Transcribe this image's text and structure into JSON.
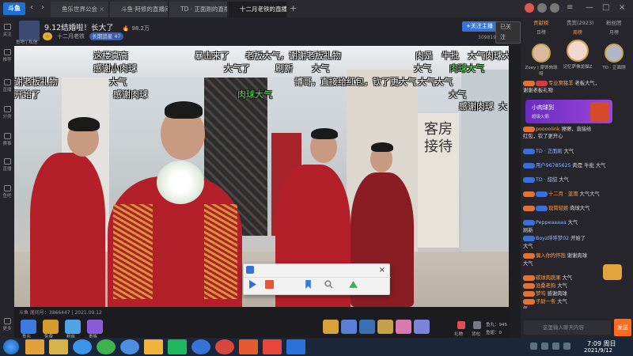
{
  "app": {
    "logo": "斗鱼",
    "nav_back": "‹",
    "nav_fwd": "›"
  },
  "tabs": [
    {
      "label": "鱼乐世界公会",
      "active": false
    },
    {
      "label": "斗鱼·阿修的直播间",
      "active": false
    },
    {
      "label": "TD · 正面刚的直播间",
      "active": false
    },
    {
      "label": "十二月老铁的直播间",
      "active": true
    }
  ],
  "tab_close": "×",
  "tab_new": "+",
  "window_controls": {
    "menu": "≡",
    "minimize": "—",
    "maximize": "□",
    "close": "×"
  },
  "sidebar": [
    {
      "label": "关注",
      "icon": "heart-icon"
    },
    {
      "label": "推荐",
      "icon": "home-icon"
    },
    {
      "label": "直播",
      "icon": "tv-icon"
    },
    {
      "label": "分类",
      "icon": "grid-icon"
    },
    {
      "label": "赛事",
      "icon": "trophy-icon"
    },
    {
      "label": "直播",
      "icon": "camera-icon"
    },
    {
      "label": "鱼吧",
      "icon": "fish-icon"
    },
    {
      "label": "更多",
      "icon": "more-icon"
    }
  ],
  "room": {
    "title": "9.12结婚啦！长大了",
    "heat": "98.2万",
    "sub_label": "十二月老铁",
    "level_badge": "长期追星 47",
    "follow_btn": "+关注主播",
    "share_btn": "已关注",
    "followers": "309819",
    "anchor_name": "鱼吧 | 私信"
  },
  "danmaku": [
    {
      "text": "这楼真高",
      "green": false
    },
    {
      "text": "暴击来了",
      "green": false
    },
    {
      "text": "老板大气，谢谢老板礼物",
      "green": false
    },
    {
      "text": "肉是",
      "green": false
    },
    {
      "text": "牛批",
      "green": false
    },
    {
      "text": "大气",
      "green": false
    },
    {
      "text": "肉球大气",
      "green": false
    },
    {
      "text": "感谢小肉球",
      "green": false
    },
    {
      "text": "大气了",
      "green": false
    },
    {
      "text": "大气",
      "green": false
    },
    {
      "text": "大气",
      "green": false
    },
    {
      "text": "肉球大气",
      "green": true
    },
    {
      "text": "谢老板礼物",
      "green": false
    },
    {
      "text": "大气",
      "green": false
    },
    {
      "text": "刷新",
      "green": false
    },
    {
      "text": "博哥，直接给红包，钦了更大气",
      "green": false
    },
    {
      "text": "大气大气",
      "green": false
    },
    {
      "text": "开始了",
      "green": false
    },
    {
      "text": "感谢肉球",
      "green": false
    },
    {
      "text": "肉球大气",
      "green": true
    },
    {
      "text": "大气",
      "green": false
    },
    {
      "text": "感谢肉球",
      "green": false
    },
    {
      "text": "大",
      "green": false
    }
  ],
  "sign_text": "客房接待",
  "video_footer": {
    "room_id": "斗鱼 房间号：3866447 | 2021.09.12"
  },
  "gifts_left": [
    {
      "label": "鱼丸",
      "color": "#3e7be0"
    },
    {
      "label": "免费",
      "color": "#d79b2c"
    },
    {
      "label": "粉丝",
      "color": "#4fa3e6"
    },
    {
      "label": "贵族",
      "color": "#8b5bd8"
    }
  ],
  "gifts_right": [
    {
      "label": "",
      "color": "#d8a13a"
    },
    {
      "label": "",
      "color": "#5a7fd6"
    },
    {
      "label": "",
      "color": "#3a6fb0"
    },
    {
      "label": "",
      "color": "#c9a04a"
    },
    {
      "label": "",
      "color": "#d77ab0"
    },
    {
      "label": "",
      "color": "#7a84d8"
    }
  ],
  "footer_right": [
    "礼物",
    "背包",
    "鱼丸：945",
    "鱼翅：0"
  ],
  "popup": {
    "close": "×"
  },
  "right_tabs": [
    "贡献榜",
    "贵宾(2923)",
    "粉丝团"
  ],
  "right_sub": [
    "日榜",
    "周榜",
    "月榜"
  ],
  "ranks": [
    {
      "name": "Zoey | 梁饰肉球呀"
    },
    {
      "name": "记忆萨佛龙猫Z"
    },
    {
      "name": "TD · 正面刚"
    }
  ],
  "chat": [
    {
      "name": "专业窝猪羊",
      "text": "老板大气，",
      "orange": true
    },
    {
      "name": "",
      "text": "谢谢老板礼物",
      "orange": false
    },
    {
      "name": "poooolink",
      "text": "擦擦，直接给",
      "orange": true
    },
    {
      "name": "",
      "text": "红包，钦了更开心",
      "orange": false
    },
    {
      "name": "TD · 正面刚",
      "text": "大气",
      "orange": false
    },
    {
      "name": "用户96785625",
      "text": "肉是 牛批 大气",
      "orange": false
    },
    {
      "name": "TD · 甜甜",
      "text": "大气",
      "orange": false
    },
    {
      "name": "十二月 · 蓝雨",
      "text": "大气大气",
      "orange": true
    },
    {
      "name": "现简轻姬",
      "text": "肉球大气",
      "orange": true
    },
    {
      "name": "Peppeaaaaa",
      "text": "大气",
      "orange": false
    },
    {
      "name": "刷新",
      "text": "",
      "orange": false
    },
    {
      "name": "Boyz呼呼梦02",
      "text": "开始了",
      "orange": false
    },
    {
      "name": "大气",
      "text": "",
      "orange": false
    },
    {
      "name": "偶入你的怀抱",
      "text": "谢谢肉球",
      "orange": true
    },
    {
      "name": "大气",
      "text": "",
      "orange": false
    },
    {
      "name": "碳球肉蔬果",
      "text": "大气",
      "orange": true
    },
    {
      "name": "沧桑老狗",
      "text": "大气",
      "orange": true
    },
    {
      "name": "梦呜",
      "text": "感谢肉球",
      "orange": true
    },
    {
      "name": "子尉一条",
      "text": "大气",
      "orange": true
    },
    {
      "name": "气",
      "text": "",
      "orange": false
    }
  ],
  "promo": {
    "title": "小肉球到",
    "sub": "超级火箭"
  },
  "chat_input_placeholder": "这里输入聊天内容",
  "send_label": "发送",
  "taskbar": {
    "time": "7:09 周日",
    "date": "2021/9/12",
    "apps": [
      {
        "name": "app-control-panel",
        "color": "#e3a13a"
      },
      {
        "name": "app-explorer",
        "color": "#d8b14a"
      },
      {
        "name": "app-browser-sogou",
        "color": "#3d95e8"
      },
      {
        "name": "app-360",
        "color": "#3fb34f"
      },
      {
        "name": "app-ie",
        "color": "#4c8fe0"
      },
      {
        "name": "app-folder",
        "color": "#f3b23b"
      },
      {
        "name": "app-video",
        "color": "#1fb85f"
      },
      {
        "name": "app-player",
        "color": "#3574d6"
      },
      {
        "name": "app-chrome",
        "color": "#d9463d"
      },
      {
        "name": "app-tool",
        "color": "#e35c2e"
      },
      {
        "name": "app-douyu",
        "color": "#e8453c"
      },
      {
        "name": "app-media",
        "color": "#2b6fd8"
      }
    ]
  }
}
